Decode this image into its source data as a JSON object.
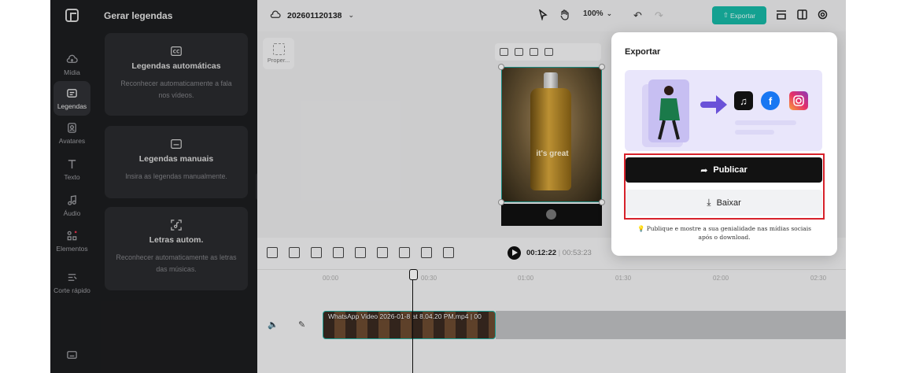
{
  "rail": {
    "items": [
      {
        "label": "Mídia"
      },
      {
        "label": "Legendas"
      },
      {
        "label": "Avatares"
      },
      {
        "label": "Texto"
      },
      {
        "label": "Áudio"
      },
      {
        "label": "Elementos"
      },
      {
        "label": "Corte rápido"
      }
    ]
  },
  "panel": {
    "title": "Gerar legendas",
    "cards": [
      {
        "title": "Legendas automáticas",
        "desc": "Reconhecer automaticamente a fala nos vídeos."
      },
      {
        "title": "Legendas manuais",
        "desc": "Insira as legendas manualmente."
      },
      {
        "title": "Letras autom.",
        "desc": "Reconhecer automaticamente as letras das músicas."
      }
    ]
  },
  "topbar": {
    "project_name": "202601120138",
    "zoom": "100%",
    "export_label": "Exportar"
  },
  "canvas": {
    "properties_label": "Proper...",
    "video_tag": "it's great"
  },
  "timeline": {
    "current_time": "00:12:22",
    "total_time": "00:53:23",
    "ticks": [
      "00:00",
      "00:30",
      "01:00",
      "01:30",
      "02:00",
      "02:30"
    ],
    "clip_label": "WhatsApp Video 2026-01-8 at 8.04.20 PM.mp4 | 00"
  },
  "export_popup": {
    "title": "Exportar",
    "publish_label": "Publicar",
    "download_label": "Baixar",
    "footer": "Publique e mostre a sua genialidade nas mídias sociais após o download."
  },
  "colors": {
    "accent": "#17b8a6",
    "highlight": "#d7222b"
  }
}
